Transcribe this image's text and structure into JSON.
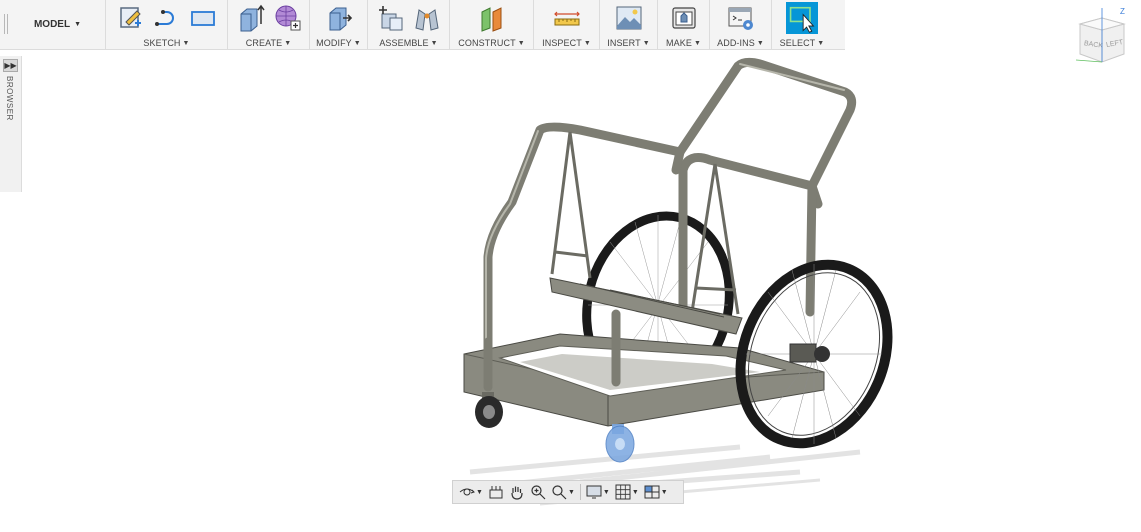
{
  "toolbar": {
    "workspace": "MODEL",
    "groups": [
      {
        "label": "SKETCH"
      },
      {
        "label": "CREATE"
      },
      {
        "label": "MODIFY"
      },
      {
        "label": "ASSEMBLE"
      },
      {
        "label": "CONSTRUCT"
      },
      {
        "label": "INSPECT"
      },
      {
        "label": "INSERT"
      },
      {
        "label": "MAKE"
      },
      {
        "label": "ADD-INS"
      },
      {
        "label": "SELECT"
      }
    ]
  },
  "browser": {
    "label": "BROWSER"
  },
  "viewcube": {
    "back": "BACK",
    "left": "LEFT",
    "z_axis": "Z"
  },
  "colors": {
    "accent": "#0696d7",
    "frame": "#7d7d73",
    "wheel": "#1a1a1a",
    "caster": "#7aa6e0"
  }
}
